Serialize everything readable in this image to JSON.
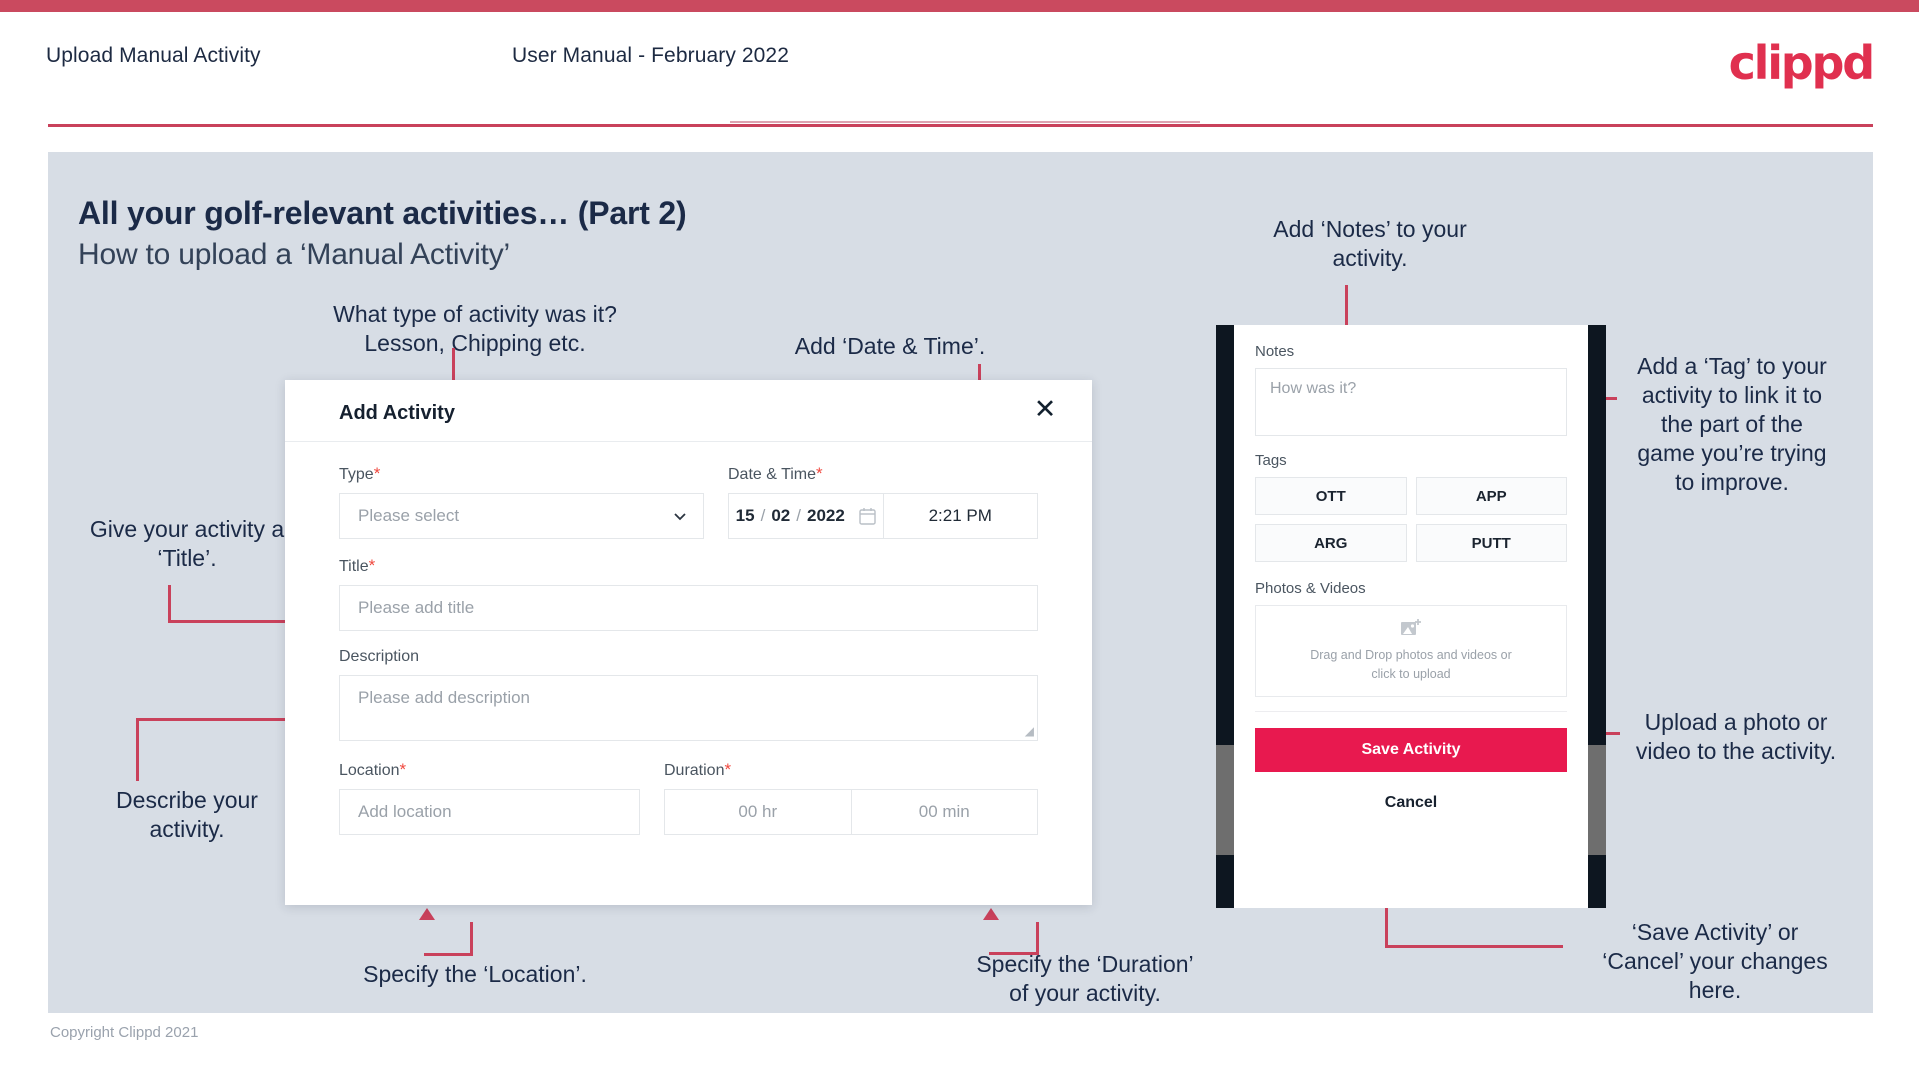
{
  "header": {
    "title": "Upload Manual Activity",
    "subtitle": "User Manual - February 2022",
    "logo": "clippd"
  },
  "slide": {
    "title": "All your golf-relevant activities… (Part 2)",
    "subtitle": "How to upload a ‘Manual Activity’"
  },
  "footer": {
    "copyright": "Copyright Clippd 2021"
  },
  "dialog": {
    "title": "Add Activity",
    "close_label": "✕",
    "fields": {
      "type": {
        "label": "Type",
        "required": "*",
        "placeholder": "Please select"
      },
      "datetime": {
        "label": "Date & Time",
        "required": "*",
        "day": "15",
        "month": "02",
        "year": "2022",
        "sep": "/",
        "time": "2:21 PM"
      },
      "title": {
        "label": "Title",
        "required": "*",
        "placeholder": "Please add title"
      },
      "description": {
        "label": "Description",
        "placeholder": "Please add description"
      },
      "location": {
        "label": "Location",
        "required": "*",
        "placeholder": "Add location"
      },
      "duration": {
        "label": "Duration",
        "required": "*",
        "hours": "00 hr",
        "minutes": "00 min"
      }
    }
  },
  "phone": {
    "notes": {
      "label": "Notes",
      "placeholder": "How was it?"
    },
    "tags": {
      "label": "Tags",
      "items": [
        "OTT",
        "APP",
        "ARG",
        "PUTT"
      ]
    },
    "photos": {
      "label": "Photos & Videos",
      "dropzone_line1": "Drag and Drop photos and videos or",
      "dropzone_line2": "click to upload"
    },
    "save_label": "Save Activity",
    "cancel_label": "Cancel"
  },
  "annotations": {
    "type": "What type of activity was it?\nLesson, Chipping etc.",
    "datetime": "Add ‘Date & Time’.",
    "title": "Give your activity a\n‘Title’.",
    "description": "Describe your\nactivity.",
    "location": "Specify the ‘Location’.",
    "duration": "Specify the ‘Duration’\nof your activity.",
    "notes": "Add ‘Notes’ to your\nactivity.",
    "tags": "Add a ‘Tag’ to your\nactivity to link it to\nthe part of the\ngame you’re trying\nto improve.",
    "upload": "Upload a photo or\nvideo to the activity.",
    "save": "‘Save Activity’ or\n‘Cancel’ your changes\nhere."
  },
  "colors": {
    "brand_red": "#e0304f",
    "accent_line": "#c9415b",
    "slide_bg": "#d7dde5",
    "save_button": "#e8194f",
    "required_star": "#f0483e",
    "text_dark": "#1b2a47"
  }
}
